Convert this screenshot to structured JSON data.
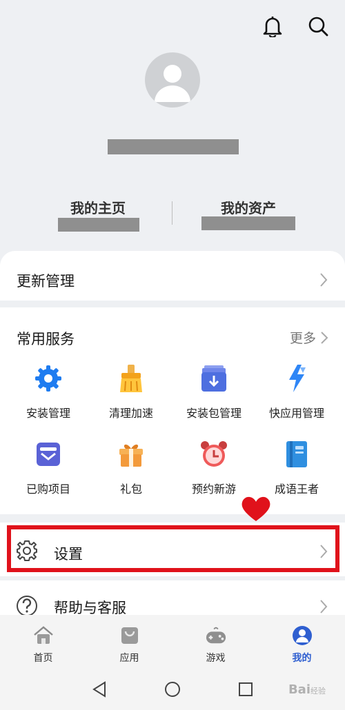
{
  "topbar": {
    "icons": [
      "bell-icon",
      "search-icon"
    ]
  },
  "profile": {
    "home_label": "我的主页",
    "assets_label": "我的资产"
  },
  "update": {
    "label": "更新管理"
  },
  "services": {
    "title": "常用服务",
    "more": "更多",
    "items": [
      {
        "label": "安装管理",
        "icon": "gear-icon",
        "color": "#1f7cf0"
      },
      {
        "label": "清理加速",
        "icon": "broom-icon",
        "color": "#f3a21b"
      },
      {
        "label": "安装包管理",
        "icon": "package-download-icon",
        "color": "#4e6fe0"
      },
      {
        "label": "快应用管理",
        "icon": "lightning-icon",
        "color": "#2f86f6"
      },
      {
        "label": "已购项目",
        "icon": "purchased-box-icon",
        "color": "#5a62d6"
      },
      {
        "label": "礼包",
        "icon": "gift-icon",
        "color": "#f39a3b"
      },
      {
        "label": "预约新游",
        "icon": "alarm-clock-icon",
        "color": "#ef5a5a"
      },
      {
        "label": "成语王者",
        "icon": "book-icon",
        "color": "#2f8fe0"
      }
    ]
  },
  "settings": {
    "label": "设置"
  },
  "help": {
    "label": "帮助与客服"
  },
  "tabs": [
    {
      "label": "首页",
      "icon": "home-icon"
    },
    {
      "label": "应用",
      "icon": "apps-bag-icon"
    },
    {
      "label": "游戏",
      "icon": "gamepad-icon"
    },
    {
      "label": "我的",
      "icon": "profile-icon",
      "active": true
    }
  ],
  "watermark": {
    "brand": "Bai",
    "sub": "经验"
  },
  "colors": {
    "accent": "#2f5fd0",
    "highlight": "#e0121b",
    "heart": "#e0121b"
  }
}
